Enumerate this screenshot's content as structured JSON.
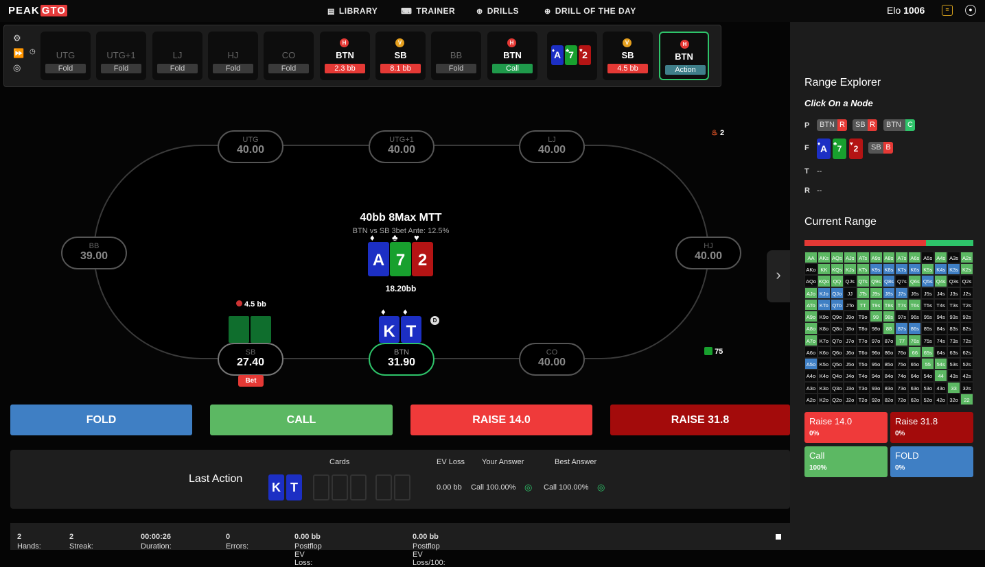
{
  "app": {
    "logo_a": "PEAK",
    "logo_b": "GTO"
  },
  "nav": [
    {
      "label": "LIBRARY",
      "icon": "book-icon"
    },
    {
      "label": "TRAINER",
      "icon": "gamepad-icon"
    },
    {
      "label": "DRILLS",
      "icon": "target-icon"
    },
    {
      "label": "DRILL OF THE DAY",
      "icon": "calendar-icon"
    }
  ],
  "user": {
    "elo_label": "Elo",
    "elo_value": "1006"
  },
  "history": [
    {
      "pos": "UTG",
      "label": "Fold",
      "kind": "fold"
    },
    {
      "pos": "UTG+1",
      "label": "Fold",
      "kind": "fold"
    },
    {
      "pos": "LJ",
      "label": "Fold",
      "kind": "fold"
    },
    {
      "pos": "HJ",
      "label": "Fold",
      "kind": "fold"
    },
    {
      "pos": "CO",
      "label": "Fold",
      "kind": "fold"
    },
    {
      "pos": "BTN",
      "label": "2.3 bb",
      "kind": "red",
      "badge": "H"
    },
    {
      "pos": "SB",
      "label": "8.1 bb",
      "kind": "red",
      "badge": "V"
    },
    {
      "pos": "BB",
      "label": "Fold",
      "kind": "fold"
    },
    {
      "pos": "BTN",
      "label": "Call",
      "kind": "green",
      "badge": "H"
    },
    {
      "pos": "SB",
      "label": "4.5 bb",
      "kind": "red",
      "badge": "V"
    },
    {
      "pos": "BTN",
      "label": "Action",
      "kind": "teal",
      "badge": "H"
    }
  ],
  "board": {
    "cards": [
      {
        "rank": "A",
        "suit": "♦",
        "color": "#1c2fc4"
      },
      {
        "rank": "7",
        "suit": "♣",
        "color": "#18a02e"
      },
      {
        "rank": "2",
        "suit": "♥",
        "color": "#b41414"
      }
    ],
    "pot": "18.20bb"
  },
  "game": {
    "title": "40bb 8Max MTT",
    "subtitle": "BTN vs SB 3bet Ante: 12.5%"
  },
  "seats": {
    "utg": {
      "pos": "UTG",
      "stack": "40.00"
    },
    "utg1": {
      "pos": "UTG+1",
      "stack": "40.00"
    },
    "lj": {
      "pos": "LJ",
      "stack": "40.00"
    },
    "bb": {
      "pos": "BB",
      "stack": "39.00"
    },
    "hj": {
      "pos": "HJ",
      "stack": "40.00"
    },
    "sb": {
      "pos": "SB",
      "stack": "27.40",
      "bet": "4.5 bb",
      "tag": "Bet"
    },
    "btn": {
      "pos": "BTN",
      "stack": "31.90",
      "dealer": "D"
    },
    "co": {
      "pos": "CO",
      "stack": "40.00"
    }
  },
  "hero": {
    "cards": [
      {
        "rank": "K",
        "suit": "♦"
      },
      {
        "rank": "T",
        "suit": "♦"
      }
    ]
  },
  "counters": {
    "streak_fire": "2",
    "dice": "75"
  },
  "actions": [
    {
      "label": "FOLD",
      "color": "#3f7fc4"
    },
    {
      "label": "CALL",
      "color": "#5cb863"
    },
    {
      "label": "RAISE 14.0",
      "color": "#ef3a3a"
    },
    {
      "label": "RAISE 31.8",
      "color": "#a30b0b"
    }
  ],
  "last_action": {
    "title": "Last Action",
    "cards_header": "Cards",
    "ev_header": "EV Loss",
    "your_header": "Your Answer",
    "best_header": "Best Answer",
    "cards": [
      "K",
      "T"
    ],
    "ev": "0.00 bb",
    "your": "Call 100.00%",
    "best": "Call 100.00%"
  },
  "status": {
    "hands_l": "Hands:",
    "hands_v": "2",
    "streak_l": "Streak:",
    "streak_v": "2",
    "dur_l": "Duration:",
    "dur_v": "00:00:26",
    "err_l": "Errors:",
    "err_v": "0",
    "pev_l": "Postflop EV Loss:",
    "pev_v": "0.00 bb",
    "pev100_l": "Postflop EV Loss/100:",
    "pev100_v": "0.00 bb"
  },
  "panel": {
    "title": "Range Explorer",
    "subtitle": "Click On a Node",
    "rows": {
      "p": "P",
      "f": "F",
      "t": "T",
      "r": "R",
      "t_val": "--",
      "r_val": "--"
    },
    "p_chips": [
      {
        "pos": "BTN",
        "act": "R",
        "kind": "r"
      },
      {
        "pos": "SB",
        "act": "R",
        "kind": "r"
      },
      {
        "pos": "BTN",
        "act": "C",
        "kind": "c"
      }
    ],
    "f_chip": {
      "pos": "SB",
      "act": "B"
    },
    "current_title": "Current Range",
    "bar": {
      "raise_pct": 72,
      "call_pct": 28
    },
    "boxes": [
      {
        "label": "Raise 14.0",
        "pct": "0%",
        "color": "#ef3a3a"
      },
      {
        "label": "Raise 31.8",
        "pct": "0%",
        "color": "#a30b0b"
      },
      {
        "label": "Call",
        "pct": "100%",
        "color": "#5cb863"
      },
      {
        "label": "FOLD",
        "pct": "0%",
        "color": "#3f7fc4"
      }
    ]
  },
  "range_grid": [
    [
      "AA",
      "AKs",
      "AQs",
      "AJs",
      "ATs",
      "A9s",
      "A8s",
      "A7s",
      "A6s",
      "A5s",
      "A4s",
      "A3s",
      "A2s"
    ],
    [
      "AKo",
      "KK",
      "KQs",
      "KJs",
      "KTs",
      "K9s",
      "K8s",
      "K7s",
      "K6s",
      "K5s",
      "K4s",
      "K3s",
      "K2s"
    ],
    [
      "AQo",
      "KQo",
      "QQ",
      "QJs",
      "QTs",
      "Q9s",
      "Q8s",
      "Q7s",
      "Q6s",
      "Q5s",
      "Q4s",
      "Q3s",
      "Q2s"
    ],
    [
      "AJo",
      "KJo",
      "QJo",
      "JJ",
      "JTs",
      "J9s",
      "J8s",
      "J7s",
      "J6s",
      "J5s",
      "J4s",
      "J3s",
      "J2s"
    ],
    [
      "ATo",
      "KTo",
      "QTo",
      "JTo",
      "TT",
      "T9s",
      "T8s",
      "T7s",
      "T6s",
      "T5s",
      "T4s",
      "T3s",
      "T2s"
    ],
    [
      "A9o",
      "K9o",
      "Q9o",
      "J9o",
      "T9o",
      "99",
      "98s",
      "97s",
      "96s",
      "95s",
      "94s",
      "93s",
      "92s"
    ],
    [
      "A8o",
      "K8o",
      "Q8o",
      "J8o",
      "T8o",
      "98o",
      "88",
      "87s",
      "86s",
      "85s",
      "84s",
      "83s",
      "82s"
    ],
    [
      "A7o",
      "K7o",
      "Q7o",
      "J7o",
      "T7o",
      "97o",
      "87o",
      "77",
      "76s",
      "75s",
      "74s",
      "73s",
      "72s"
    ],
    [
      "A6o",
      "K6o",
      "Q6o",
      "J6o",
      "T6o",
      "96o",
      "86o",
      "76o",
      "66",
      "65s",
      "64s",
      "63s",
      "62s"
    ],
    [
      "A5o",
      "K5o",
      "Q5o",
      "J5o",
      "T5o",
      "95o",
      "85o",
      "75o",
      "65o",
      "55",
      "54s",
      "53s",
      "52s"
    ],
    [
      "A4o",
      "K4o",
      "Q4o",
      "J4o",
      "T4o",
      "94o",
      "84o",
      "74o",
      "64o",
      "54o",
      "44",
      "43s",
      "42s"
    ],
    [
      "A3o",
      "K3o",
      "Q3o",
      "J3o",
      "T3o",
      "93o",
      "83o",
      "73o",
      "63o",
      "53o",
      "43o",
      "33",
      "32s"
    ],
    [
      "A2o",
      "K2o",
      "Q2o",
      "J2o",
      "T2o",
      "92o",
      "82o",
      "72o",
      "62o",
      "52o",
      "42o",
      "32o",
      "22"
    ]
  ],
  "range_colors": [
    "gggggggggkgkg",
    "kggggbbbbgbbg",
    "kggkggbkgbgkk",
    "gbbkggbbkkkkk",
    "gbbkgggggkkkk",
    "gkkkkggkkkkkk",
    "gkkkkkgbbkkkk",
    "gkkkkkkggkkkk",
    "kkkkkkkkggkkk",
    "bkkkkkkkkggkk",
    "kkkkkkkkkkgkk",
    "kkkkkkkkkkkgk",
    "kkkkkkkkkkkkg"
  ]
}
